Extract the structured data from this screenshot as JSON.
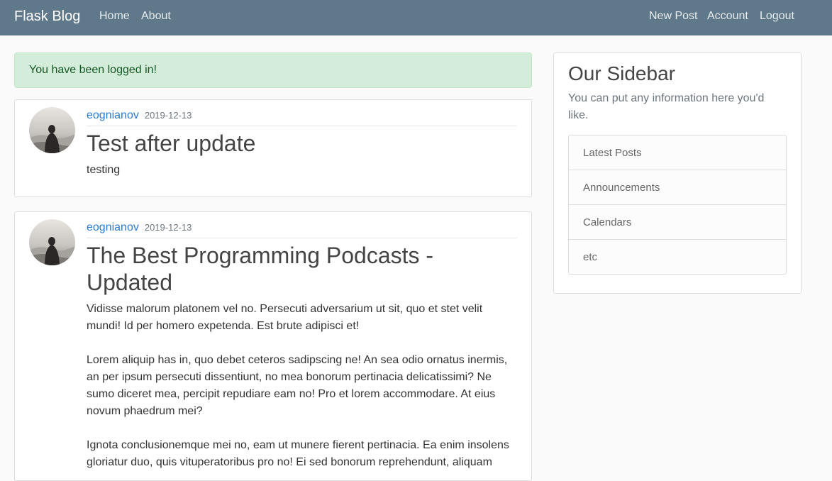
{
  "nav": {
    "brand": "Flask Blog",
    "left_links": [
      "Home",
      "About"
    ],
    "right_links": [
      "New Post",
      "Account",
      "Logout"
    ]
  },
  "alert": {
    "message": "You have been logged in!"
  },
  "posts": [
    {
      "author": "eognianov",
      "date": "2019-12-13",
      "title": "Test after update",
      "content": "testing"
    },
    {
      "author": "eognianov",
      "date": "2019-12-13",
      "title": "The Best Programming Podcasts - Updated",
      "content": "Vidisse malorum platonem vel no. Persecuti adversarium ut sit, quo et stet velit mundi! Id per homero expetenda. Est brute adipisci et!\n\nLorem aliquip has in, quo debet ceteros sadipscing ne! An sea odio ornatus inermis, an per ipsum persecuti dissentiunt, no mea bonorum pertinacia delicatissimi? Ne sumo diceret mea, percipit repudiare eam no! Pro et lorem accommodare. At eius novum phaedrum mei?\n\nIgnota conclusionemque mei no, eam ut munere fierent pertinacia. Ea enim insolens gloriatur duo, quis vituperatoribus pro no! Ei sed bonorum reprehendunt, aliquam"
    }
  ],
  "sidebar": {
    "title": "Our Sidebar",
    "text": "You can put any information here you'd like.",
    "items": [
      "Latest Posts",
      "Announcements",
      "Calendars",
      "etc"
    ]
  }
}
